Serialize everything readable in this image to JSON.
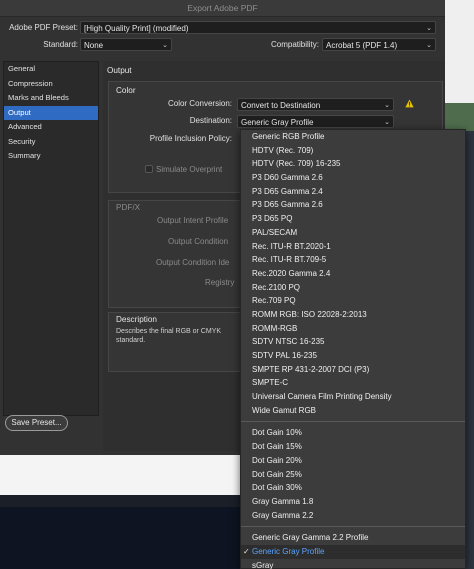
{
  "window": {
    "title": "Export Adobe PDF"
  },
  "preset": {
    "label": "Adobe PDF Preset:",
    "value": "[High Quality Print] (modified)"
  },
  "standard": {
    "label": "Standard:",
    "value": "None"
  },
  "compatibility": {
    "label": "Compatibility:",
    "value": "Acrobat 5 (PDF 1.4)"
  },
  "sidebar": {
    "items": [
      {
        "label": "General"
      },
      {
        "label": "Compression"
      },
      {
        "label": "Marks and Bleeds"
      },
      {
        "label": "Output",
        "selected": true
      },
      {
        "label": "Advanced"
      },
      {
        "label": "Security"
      },
      {
        "label": "Summary"
      }
    ]
  },
  "panel": {
    "title": "Output",
    "color": {
      "title": "Color",
      "conversion_label": "Color Conversion:",
      "conversion_value": "Convert to Destination",
      "destination_label": "Destination:",
      "destination_value": "Generic Gray Profile",
      "inclusion_label": "Profile Inclusion Policy:",
      "simulate_label": "Simulate Overprint"
    },
    "pdfx": {
      "title": "PDF/X",
      "intent_label": "Output Intent Profile",
      "condition_label": "Output Condition",
      "condition_id_label": "Output Condition Ide",
      "registry_label": "Registry"
    },
    "description": {
      "title": "Description",
      "text": "Describes the final RGB or CMYK standard."
    }
  },
  "buttons": {
    "save_preset": "Save Preset..."
  },
  "menu": {
    "groups": [
      [
        "Generic RGB Profile",
        "HDTV (Rec. 709)",
        "HDTV (Rec. 709) 16-235",
        "P3 D60 Gamma 2.6",
        "P3 D65 Gamma 2.4",
        "P3 D65 Gamma 2.6",
        "P3 D65 PQ",
        "PAL/SECAM",
        "Rec. ITU-R BT.2020-1",
        "Rec. ITU-R BT.709-5",
        "Rec.2020 Gamma 2.4",
        "Rec.2100 PQ",
        "Rec.709 PQ",
        "ROMM RGB: ISO 22028-2:2013",
        "ROMM-RGB",
        "SDTV NTSC 16-235",
        "SDTV PAL 16-235",
        "SMPTE RP 431-2-2007 DCI (P3)",
        "SMPTE-C",
        "Universal Camera Film Printing Density",
        "Wide Gamut RGB"
      ],
      [
        "Dot Gain 10%",
        "Dot Gain 15%",
        "Dot Gain 20%",
        "Dot Gain 25%",
        "Dot Gain 30%",
        "Gray Gamma 1.8",
        "Gray Gamma 2.2"
      ],
      [
        "Generic Gray Gamma 2.2 Profile",
        "Generic Gray Profile",
        "sGray"
      ]
    ],
    "selected": "Generic Gray Profile",
    "check_glyph": "✓"
  },
  "colors": {
    "accent": "#2f6bc2",
    "menu_selected_text": "#5aa4ff",
    "warning": "#e5c100"
  },
  "icons": {
    "warning": "warning-triangle-icon",
    "chevron": "chevron-updown-icon"
  }
}
